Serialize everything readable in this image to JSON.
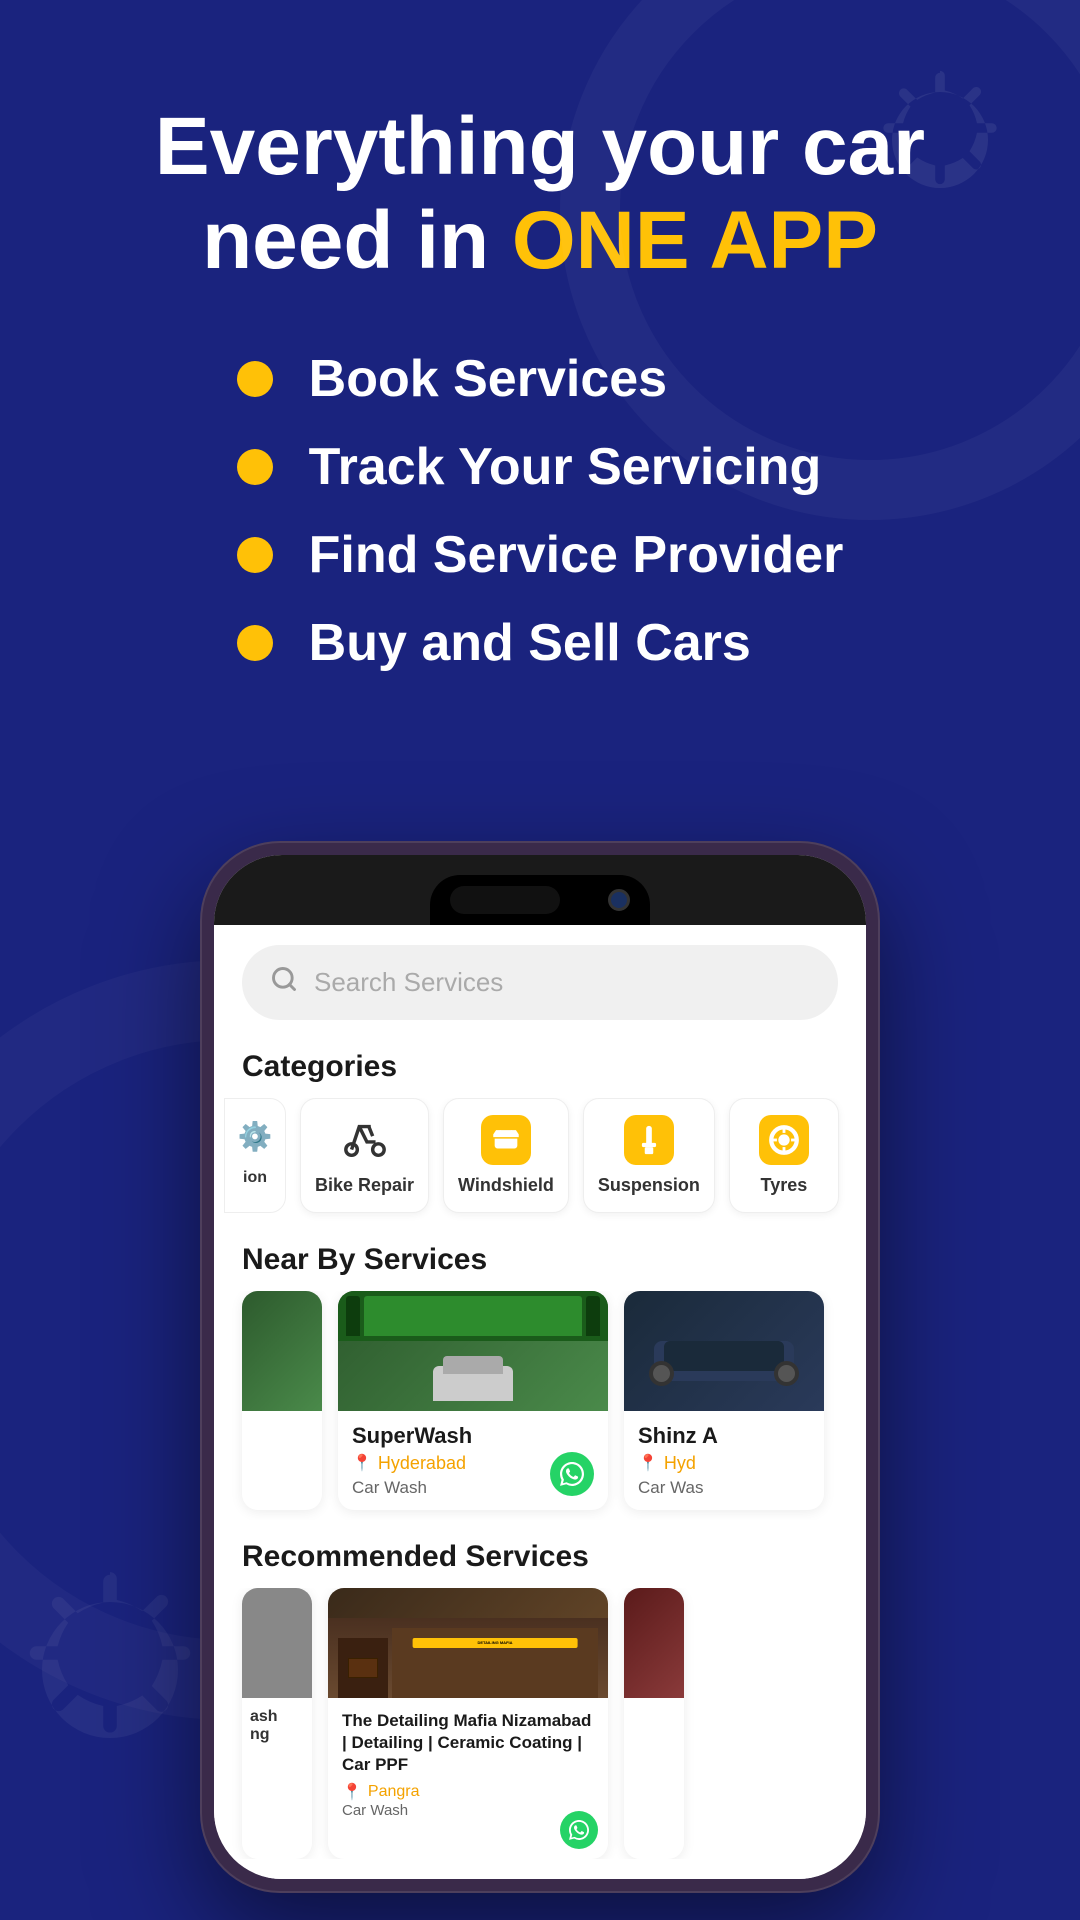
{
  "hero": {
    "title_line1": "Everything your car",
    "title_line2": "need in ",
    "title_highlight": "ONE APP",
    "features": [
      {
        "id": "book",
        "text": "Book Services"
      },
      {
        "id": "track",
        "text": "Track Your Servicing"
      },
      {
        "id": "find",
        "text": "Find Service Provider"
      },
      {
        "id": "buy",
        "text": "Buy and Sell Cars"
      }
    ]
  },
  "phone": {
    "screen": {
      "search": {
        "placeholder": "Search Services"
      },
      "categories_title": "Categories",
      "categories": [
        {
          "id": "partial",
          "label": "ion",
          "icon": "⚙️",
          "type": "partial"
        },
        {
          "id": "bike_repair",
          "label": "Bike Repair",
          "icon": "gear",
          "type": "gear"
        },
        {
          "id": "windshield",
          "label": "Windshield",
          "icon": "windshield",
          "type": "yellow"
        },
        {
          "id": "suspension",
          "label": "Suspension",
          "icon": "suspension",
          "type": "yellow"
        },
        {
          "id": "tyres",
          "label": "Tyres",
          "icon": "tyre",
          "type": "yellow"
        }
      ],
      "nearby_title": "Near By Services",
      "nearby_services": [
        {
          "id": "superwash",
          "name": "SuperWash",
          "location": "Hyderabad",
          "type": "Car Wash",
          "img_type": "green"
        },
        {
          "id": "shinz",
          "name": "Shinz A",
          "location": "Hyd",
          "type": "Car Was",
          "img_type": "dark"
        }
      ],
      "recommended_title": "Recommended Services",
      "recommended_services": [
        {
          "id": "partial_left",
          "name": "ash\ning",
          "type": "partial"
        },
        {
          "id": "detailing_mafia",
          "name": "The Detailing Mafia Nizamabad | Detailing | Ceramic Coating | Car PPF",
          "location": "Pangra",
          "type": "Car Wash",
          "img_type": "detailing"
        },
        {
          "id": "partial_right",
          "type": "partial_right"
        }
      ]
    }
  },
  "colors": {
    "background": "#1a237e",
    "accent_yellow": "#FFC107",
    "white": "#ffffff",
    "whatsapp_green": "#25D366"
  }
}
